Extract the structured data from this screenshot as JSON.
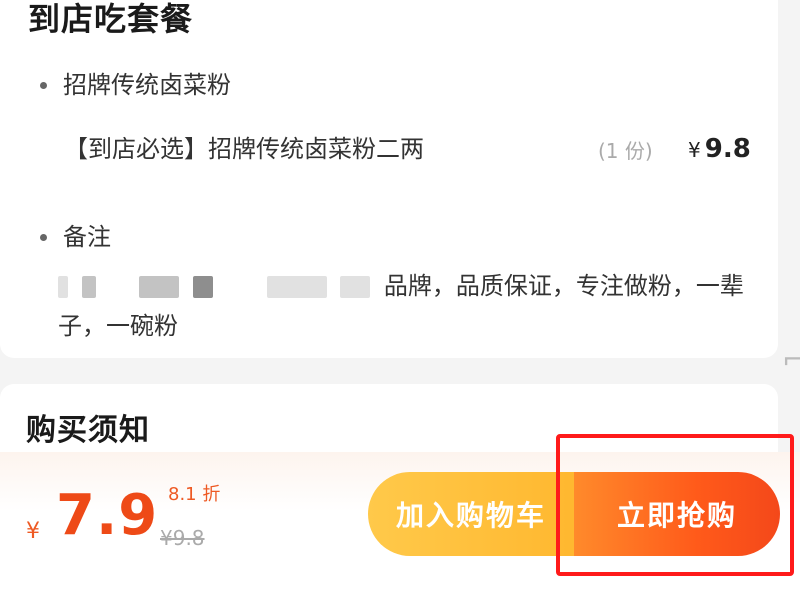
{
  "package": {
    "title": "到店吃套餐",
    "category_label": "招牌传统卤菜粉",
    "item": {
      "name": "【到店必选】招牌传统卤菜粉二两",
      "quantity": "(1 份)",
      "currency": "¥",
      "price": "9.8"
    },
    "note_label": "备注",
    "note_text_visible": "品牌，品质保证，专注做粉，一辈子，一碗粉"
  },
  "purchase_notes": {
    "title": "购买须知"
  },
  "checkout": {
    "currency": "¥",
    "price": "7.9",
    "discount": "8.1 折",
    "original_price": "¥9.8",
    "add_to_cart_label": "加入购物车",
    "buy_now_label": "立即抢购"
  },
  "colors": {
    "accent": "#ee4a17",
    "cart_button": "#ffb52b",
    "buy_button": "#ff5a1a",
    "highlight": "#ff1a1a"
  }
}
